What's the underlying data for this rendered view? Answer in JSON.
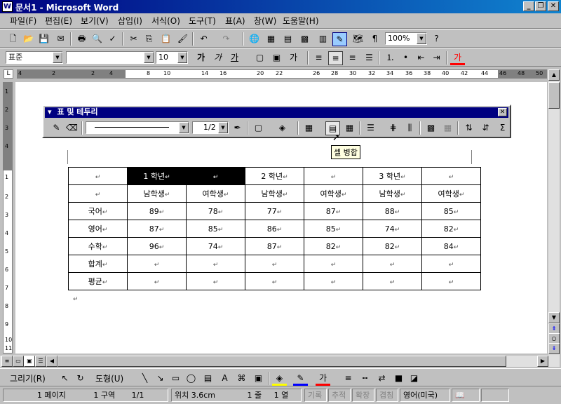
{
  "window": {
    "title": "문서1 - Microsoft Word",
    "icon": "word-doc-icon"
  },
  "menu": [
    "파일(F)",
    "편집(E)",
    "보기(V)",
    "삽입(I)",
    "서식(O)",
    "도구(T)",
    "표(A)",
    "창(W)",
    "도움말(H)"
  ],
  "standard_toolbar": {
    "zoom": "100%"
  },
  "format_toolbar": {
    "style": "표준",
    "font": "",
    "size": "10",
    "bold": "가",
    "italic": "가",
    "underline": "가",
    "font_color_label": "가"
  },
  "ruler": {
    "h_ticks": [
      "4",
      "2",
      "2",
      "4",
      "8",
      "10",
      "14",
      "16",
      "20",
      "22",
      "26",
      "28",
      "30",
      "32",
      "34",
      "36",
      "38",
      "40",
      "42",
      "44",
      "46",
      "48",
      "50"
    ],
    "v_ticks": [
      "1",
      "2",
      "3",
      "4",
      "1",
      "2",
      "3",
      "4",
      "5",
      "6",
      "7",
      "8",
      "9",
      "10",
      "11"
    ]
  },
  "table_toolbar": {
    "title": "표 및 테두리",
    "line_weight": "1/2"
  },
  "tooltip": "셀 병합",
  "grid": {
    "mark": "↵",
    "row1": [
      "",
      "1 학년",
      "",
      "2 학년",
      "",
      "3 학년",
      ""
    ],
    "row2": [
      "",
      "남학생",
      "여학생",
      "남학생",
      "여학생",
      "남학생",
      "여학생"
    ],
    "rows": [
      {
        "label": "국어",
        "values": [
          "89",
          "78",
          "77",
          "87",
          "88",
          "85"
        ]
      },
      {
        "label": "영어",
        "values": [
          "87",
          "85",
          "86",
          "85",
          "74",
          "82"
        ]
      },
      {
        "label": "수학",
        "values": [
          "96",
          "74",
          "87",
          "82",
          "82",
          "84"
        ]
      },
      {
        "label": "합계",
        "values": [
          "",
          "",
          "",
          "",
          "",
          ""
        ]
      },
      {
        "label": "평균",
        "values": [
          "",
          "",
          "",
          "",
          "",
          ""
        ]
      }
    ]
  },
  "drawing_toolbar": {
    "draw": "그리기(R)",
    "autoshape": "도형(U)",
    "font_color": "가"
  },
  "status": {
    "page": "1 페이지",
    "section": "1 구역",
    "pages": "1/1",
    "position": "위치 3.6cm",
    "line": "1 줄",
    "col": "1 열",
    "rec": "기록",
    "trk": "추적",
    "ext": "확장",
    "ovr": "겹침",
    "lang": "영어(미국)"
  },
  "colors": {
    "title_bg": "#000080",
    "highlight": "#ffff00",
    "font_red": "#ff0000",
    "selection": "#000000"
  }
}
